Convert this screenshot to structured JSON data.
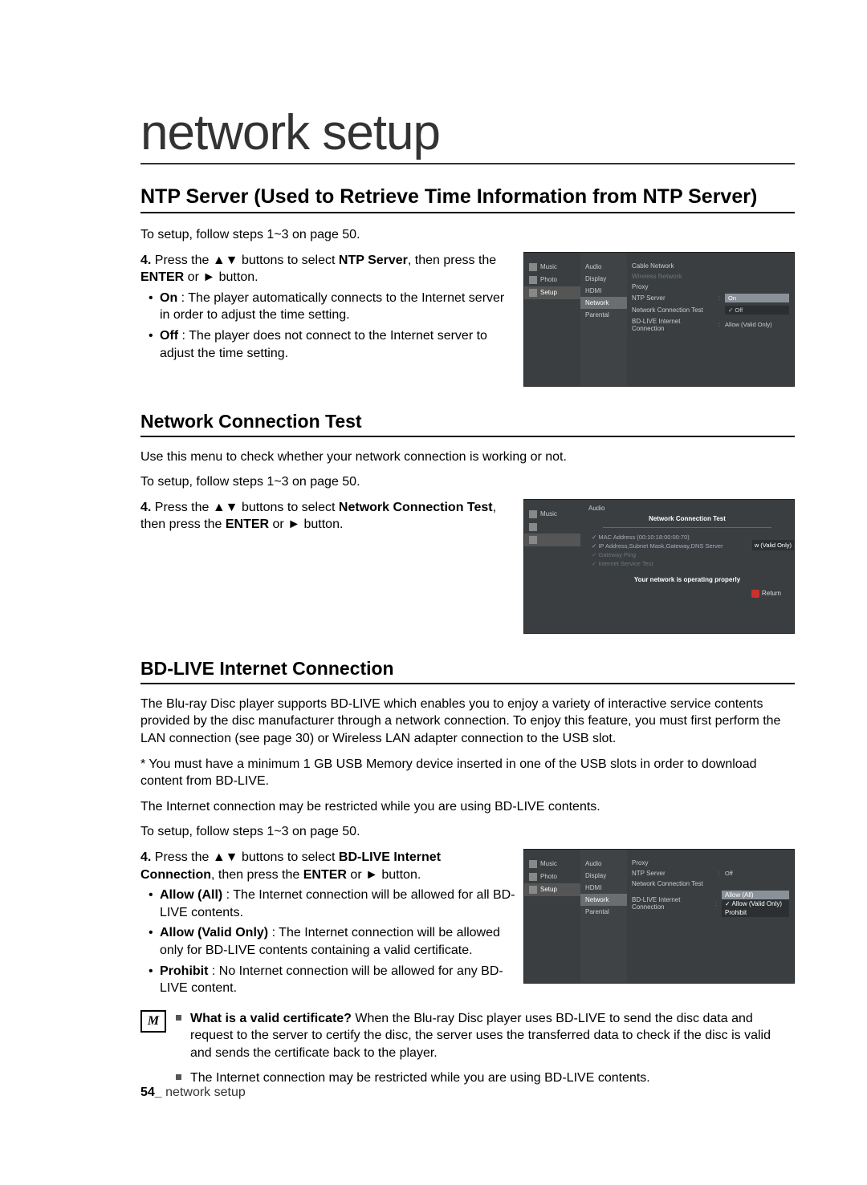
{
  "page": {
    "main_title": "network setup",
    "footer_page": "54_",
    "footer_label": " network setup"
  },
  "s1": {
    "heading": "NTP Server (Used to Retrieve Time Information from NTP Server)",
    "intro": "To setup, follow steps 1~3 on page 50.",
    "step_prefix": "4.",
    "step_a": " Press the ▲▼ buttons to select ",
    "step_bold": "NTP Server",
    "step_b": ", then press the ",
    "step_bold2": "ENTER",
    "step_c": " or ► button.",
    "on_bold": "On",
    "on_text": " : The player automatically connects to the Internet server in order to adjust the time setting.",
    "off_bold": "Off",
    "off_text": " : The player does not connect to the Internet server to adjust the time setting.",
    "scr": {
      "left_music": "Music",
      "left_photo": "Photo",
      "left_setup": "Setup",
      "mid": [
        "Audio",
        "Display",
        "HDMI",
        "Network",
        "Parental"
      ],
      "right_items": [
        {
          "k": "Cable Network",
          "v": ""
        },
        {
          "k": "Wireless Network",
          "v": "",
          "dim": true
        },
        {
          "k": "Proxy",
          "v": ""
        },
        {
          "k": "NTP Server",
          "v": "On"
        },
        {
          "k": "Network Connection Test",
          "v": "Off",
          "chk": true
        },
        {
          "k": "BD-LIVE Internet Connection",
          "v": "Allow (Valid Only)"
        }
      ]
    }
  },
  "s2": {
    "heading": "Network Connection Test",
    "p1": "Use this menu to check whether your network connection is working or not.",
    "p2": "To setup, follow steps 1~3 on page 50.",
    "step_prefix": "4.",
    "step_a": " Press the ▲▼ buttons to select ",
    "step_bold": "Network Connection Test",
    "step_b": ", then press the ",
    "step_bold2": "ENTER",
    "step_c": " or ► button.",
    "scr": {
      "left_music": "Music",
      "audio": "Audio",
      "title": "Network Connection Test",
      "checks": [
        "✓ MAC Address (00:10:18:00:00:70)",
        "✓ IP Address,Subnet Mask,Gateway,DNS Server",
        "✓ Gateway Ping",
        "✓ Internet Service Test"
      ],
      "side_label": "w (Valid Only)",
      "status": "Your network is operating properly",
      "return": "Return"
    }
  },
  "s3": {
    "heading": "BD-LIVE Internet Connection",
    "p1": "The Blu-ray Disc player supports BD-LIVE which enables you to enjoy a variety of interactive service contents provided by the disc manufacturer through a network connection. To enjoy this feature, you must first perform the LAN connection (see page 30) or Wireless LAN adapter connection to the USB slot.",
    "p2": "* You must have a minimum 1 GB USB Memory device inserted in one of the USB slots in order to download content from BD-LIVE.",
    "p3": "The Internet connection may be restricted while you are using BD-LIVE contents.",
    "p4": "To setup, follow steps 1~3 on page 50.",
    "step_prefix": "4.",
    "step_a": " Press the ▲▼ buttons to select ",
    "step_bold": "BD-LIVE Internet Connection",
    "step_b": ", then press the ",
    "step_bold2": "ENTER",
    "step_c": " or ► button.",
    "b1_bold": "Allow (All)",
    "b1_text": " : The Internet connection will be allowed for all BD-LIVE contents.",
    "b2_bold": "Allow (Valid Only)",
    "b2_text": " : The Internet connection will be allowed only for BD-LIVE contents containing a valid certificate.",
    "b3_bold": "Prohibit",
    "b3_text": " : No Internet connection will be allowed for any BD-LIVE content.",
    "scr": {
      "left_music": "Music",
      "left_photo": "Photo",
      "left_setup": "Setup",
      "mid": [
        "Audio",
        "Display",
        "HDMI",
        "Network",
        "Parental"
      ],
      "right": {
        "proxy": "Proxy",
        "ntp_k": "NTP Server",
        "ntp_v": "Off",
        "nct": "Network Connection Test",
        "bd_k": "BD-LIVE Internet Connection",
        "opts": [
          "Allow (All)",
          "Allow (Valid Only)",
          "Prohibit"
        ]
      }
    },
    "note1_bold": "What is a valid certificate?",
    "note1": " When the Blu-ray Disc player uses BD-LIVE to send the disc data and request to the server to certify the disc, the server uses the transferred data to check if the disc is valid and sends the certificate back to the player.",
    "note2": "The Internet connection may be restricted while you are using BD-LIVE contents.",
    "note_icon": "M"
  }
}
